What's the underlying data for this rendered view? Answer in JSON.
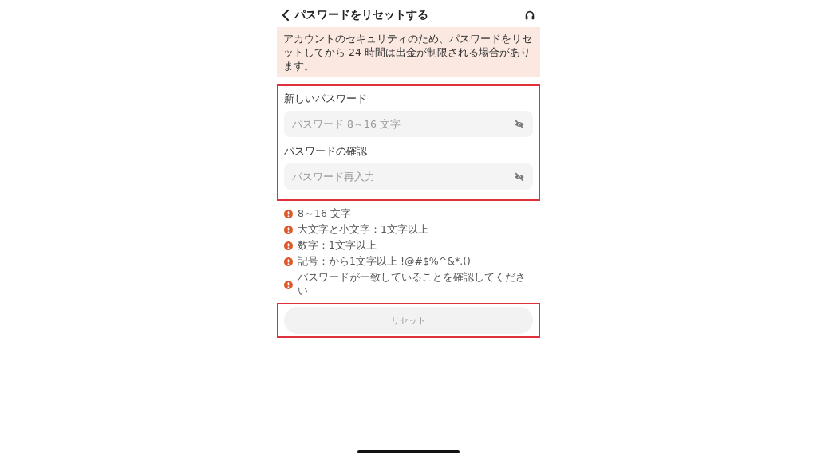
{
  "header": {
    "title": "パスワードをリセットする"
  },
  "notice": "アカウントのセキュリティのため、パスワードをリセットしてから 24 時間は出金が制限される場合があります。",
  "form": {
    "highlighted": true,
    "fields": [
      {
        "label": "新しいパスワード",
        "placeholder": "パスワード 8～16 文字",
        "visible": false
      },
      {
        "label": "パスワードの確認",
        "placeholder": "パスワード再入力",
        "visible": false
      }
    ]
  },
  "rules": [
    {
      "text": "8～16 文字",
      "met": false
    },
    {
      "text": "大文字と小文字：1文字以上",
      "met": false
    },
    {
      "text": "数字：1文字以上",
      "met": false
    },
    {
      "text": "記号：から1文字以上 !@#$%^&*.()",
      "met": false
    },
    {
      "text": "パスワードが一致していることを確認してください",
      "met": false
    }
  ],
  "submit": {
    "label": "リセット",
    "disabled": true,
    "highlighted": true
  }
}
